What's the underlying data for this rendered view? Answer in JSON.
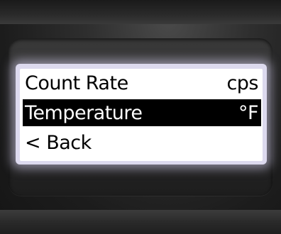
{
  "menu": {
    "items": [
      {
        "label": "Count Rate",
        "value": "cps",
        "selected": false
      },
      {
        "label": "Temperature",
        "value": "°F",
        "selected": true
      },
      {
        "label": "< Back",
        "value": "",
        "selected": false
      }
    ]
  },
  "colors": {
    "screen_background": "#ffffff",
    "highlight_background": "#000000",
    "highlight_text": "#ffffff",
    "text": "#000000",
    "housing": "#2b2b2b"
  }
}
